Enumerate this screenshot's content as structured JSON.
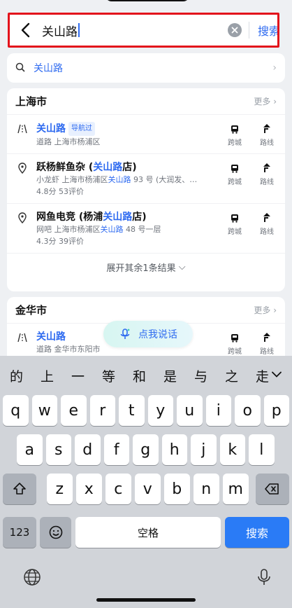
{
  "search": {
    "query": "关山路",
    "button": "搜索"
  },
  "suggestion": {
    "text": "关山路",
    "icon": "search-icon"
  },
  "results_shanghai": {
    "title": "上海市",
    "more": "更多",
    "items": [
      {
        "name_hl": "关山路",
        "name_rest": "",
        "tag": "导航过",
        "meta": "道路  上海市杨浦区",
        "rating": ""
      },
      {
        "name_pre": "跃杨鲜鱼杂 (",
        "name_hl": "关山路",
        "name_post": "店)",
        "meta_pre": "小龙虾  上海市杨浦区",
        "meta_hl": "关山路",
        "meta_post": " 93 号 (大润发、华联...",
        "rating": "4.8分  53评价"
      },
      {
        "name_pre": "网鱼电竞 (杨浦",
        "name_hl": "关山路",
        "name_post": "店)",
        "meta_pre": "网吧  上海市杨浦区",
        "meta_hl": "关山路",
        "meta_post": " 48 号一层",
        "rating": "4.3分  39评价"
      }
    ],
    "expand": "展开其余1条结果"
  },
  "results_jinhua": {
    "title": "金华市",
    "more": "更多",
    "item": {
      "name_hl": "关山路",
      "meta": "道路  金华市东阳市"
    }
  },
  "actions": {
    "transit": "跨城",
    "route": "路线"
  },
  "voice": {
    "label": "点我说话"
  },
  "keyboard": {
    "candidates": [
      "的",
      "上",
      "一",
      "等",
      "和",
      "是",
      "与",
      "之",
      "走"
    ],
    "row1": [
      "q",
      "w",
      "e",
      "r",
      "t",
      "y",
      "u",
      "i",
      "o",
      "p"
    ],
    "row2": [
      "a",
      "s",
      "d",
      "f",
      "g",
      "h",
      "j",
      "k",
      "l"
    ],
    "row3": [
      "z",
      "x",
      "c",
      "v",
      "b",
      "n",
      "m"
    ],
    "num": "123",
    "space": "空格",
    "enter": "搜索"
  },
  "colors": {
    "accent": "#2f6bf0",
    "highlight_border": "#e3121b",
    "key_blue": "#2a7bf6"
  }
}
